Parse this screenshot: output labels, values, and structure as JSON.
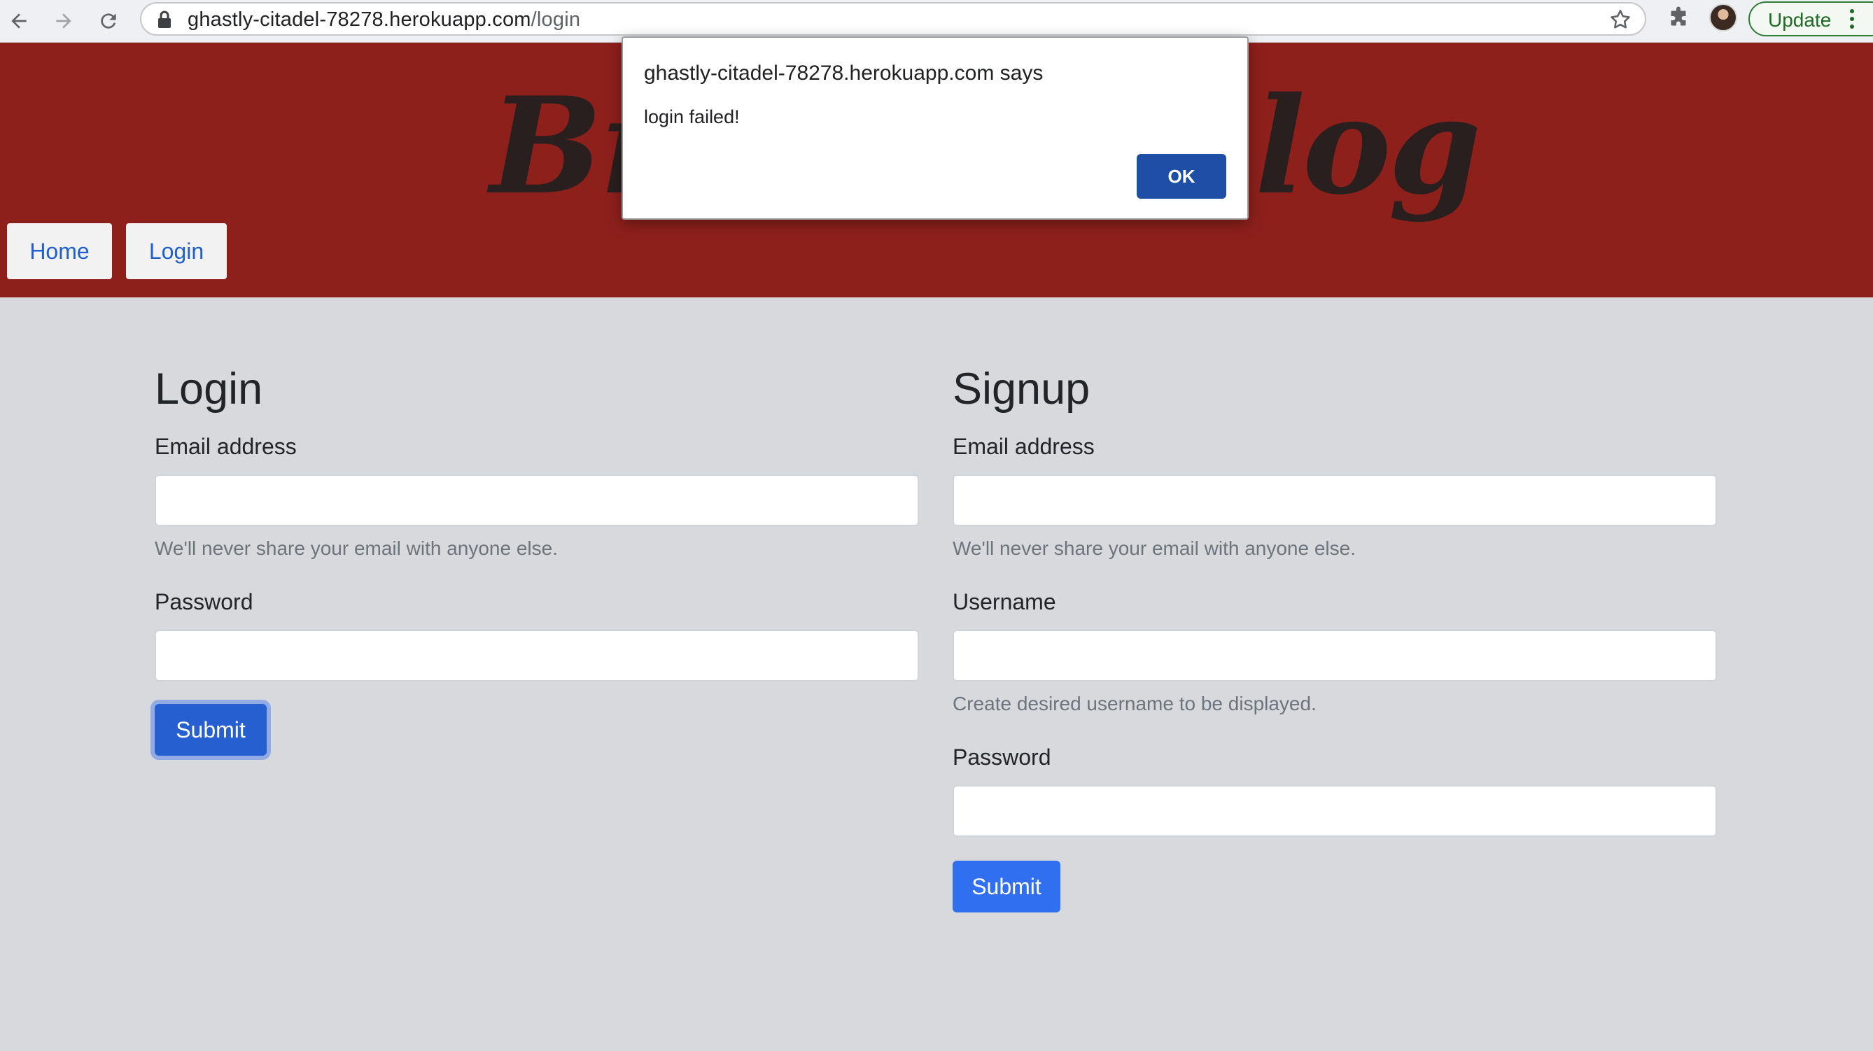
{
  "browser": {
    "url_host": "ghastly-citadel-78278.herokuapp.com",
    "url_path": "/login",
    "update_label": "Update",
    "icons": [
      "back-arrow-icon",
      "forward-arrow-icon",
      "reload-icon",
      "lock-icon",
      "star-icon",
      "puzzle-icon",
      "avatar",
      "kebab-menu-icon"
    ]
  },
  "header": {
    "logo_left": "Br",
    "logo_right": "log",
    "nav": [
      {
        "label": "Home"
      },
      {
        "label": "Login"
      }
    ],
    "colors": {
      "background": "#8e201c",
      "nav_link": "#1f5fd4"
    }
  },
  "login": {
    "title": "Login",
    "email_label": "Email address",
    "email_help": "We'll never share your email with anyone else.",
    "email_value": "",
    "password_label": "Password",
    "password_value": "",
    "submit_label": "Submit"
  },
  "signup": {
    "title": "Signup",
    "email_label": "Email address",
    "email_help": "We'll never share your email with anyone else.",
    "email_value": "",
    "username_label": "Username",
    "username_help": "Create desired username to be displayed.",
    "username_value": "",
    "password_label": "Password",
    "password_value": "",
    "submit_label": "Submit"
  },
  "alert": {
    "title": "ghastly-citadel-78278.herokuapp.com says",
    "message": "login failed!",
    "ok_label": "OK"
  }
}
